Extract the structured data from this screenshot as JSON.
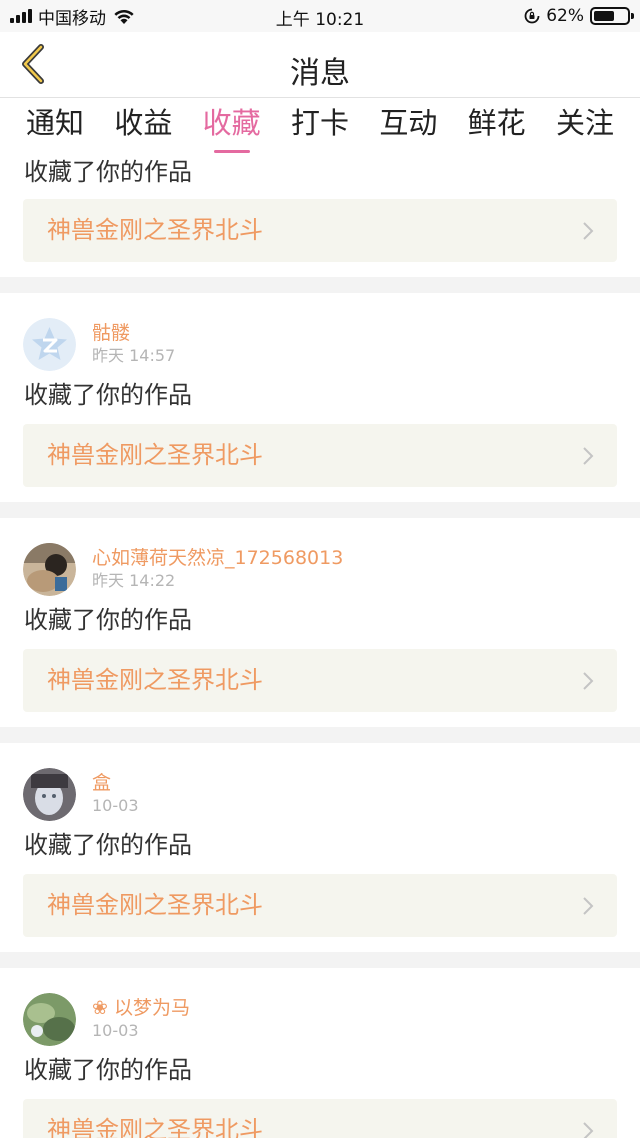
{
  "status_bar": {
    "carrier": "中国移动",
    "time": "上午 10:21",
    "battery_percent": "62%",
    "battery_level": 0.62
  },
  "nav": {
    "title": "消息",
    "back_icon": "chevron-left-icon",
    "accent_color": "#e46aa0"
  },
  "tabs": [
    {
      "label": "通知",
      "active": false
    },
    {
      "label": "收益",
      "active": false
    },
    {
      "label": "收藏",
      "active": true
    },
    {
      "label": "打卡",
      "active": false
    },
    {
      "label": "互动",
      "active": false
    },
    {
      "label": "鲜花",
      "active": false
    },
    {
      "label": "关注",
      "active": false
    }
  ],
  "messages": [
    {
      "username": "",
      "time": "",
      "action": "收藏了你的作品",
      "work": "神兽金刚之圣界北斗"
    },
    {
      "username": "骷髅",
      "time": "昨天 14:57",
      "action": "收藏了你的作品",
      "work": "神兽金刚之圣界北斗",
      "avatar": "qzone-default-avatar"
    },
    {
      "username": "心如薄荷天然凉_172568013",
      "time": "昨天 14:22",
      "action": "收藏了你的作品",
      "work": "神兽金刚之圣界北斗",
      "avatar": "photo-avatar"
    },
    {
      "username": "盒",
      "time": "10-03",
      "action": "收藏了你的作品",
      "work": "神兽金刚之圣界北斗",
      "avatar": "photo-avatar"
    },
    {
      "username": "❀ 以梦为马",
      "time": "10-03",
      "action": "收藏了你的作品",
      "work": "神兽金刚之圣界北斗",
      "avatar": "photo-avatar"
    }
  ],
  "colors": {
    "username": "#ef9a62",
    "work_title": "#ef9a62",
    "work_box_bg": "#f5f5ee",
    "separator": "#f3f3f3"
  }
}
